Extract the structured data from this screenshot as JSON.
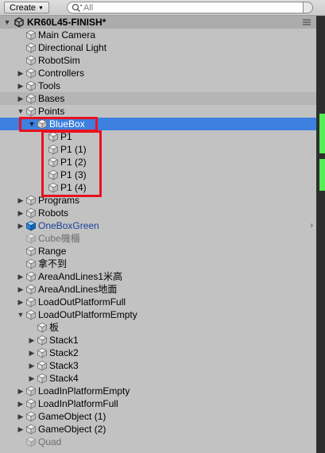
{
  "toolbar": {
    "create_label": "Create",
    "search_placeholder": "All"
  },
  "scene": {
    "title": "KR60L45-FINISH*",
    "icon": "unity-icon"
  },
  "rows": [
    {
      "label": "Main Camera",
      "depth": 1,
      "fold": "none",
      "icon": "gameobject-icon",
      "style": ""
    },
    {
      "label": "Directional Light",
      "depth": 1,
      "fold": "none",
      "icon": "gameobject-icon",
      "style": ""
    },
    {
      "label": "RobotSim",
      "depth": 1,
      "fold": "none",
      "icon": "gameobject-icon",
      "style": ""
    },
    {
      "label": "Controllers",
      "depth": 1,
      "fold": "collapsed",
      "icon": "gameobject-icon",
      "style": ""
    },
    {
      "label": "Tools",
      "depth": 1,
      "fold": "collapsed",
      "icon": "gameobject-icon",
      "style": ""
    },
    {
      "label": "Bases",
      "depth": 1,
      "fold": "collapsed",
      "icon": "gameobject-icon",
      "style": "section"
    },
    {
      "label": "Points",
      "depth": 1,
      "fold": "expanded",
      "icon": "gameobject-icon",
      "style": ""
    },
    {
      "label": "BlueBox",
      "depth": 2,
      "fold": "expanded",
      "icon": "gameobject-icon",
      "style": "selected"
    },
    {
      "label": "P1",
      "depth": 3,
      "fold": "none",
      "icon": "gameobject-icon",
      "style": ""
    },
    {
      "label": "P1 (1)",
      "depth": 3,
      "fold": "none",
      "icon": "gameobject-icon",
      "style": ""
    },
    {
      "label": "P1 (2)",
      "depth": 3,
      "fold": "none",
      "icon": "gameobject-icon",
      "style": ""
    },
    {
      "label": "P1 (3)",
      "depth": 3,
      "fold": "none",
      "icon": "gameobject-icon",
      "style": ""
    },
    {
      "label": "P1 (4)",
      "depth": 3,
      "fold": "none",
      "icon": "gameobject-icon",
      "style": ""
    },
    {
      "label": "Programs",
      "depth": 1,
      "fold": "collapsed",
      "icon": "gameobject-icon",
      "style": ""
    },
    {
      "label": "Robots",
      "depth": 1,
      "fold": "collapsed",
      "icon": "gameobject-icon",
      "style": ""
    },
    {
      "label": "OneBoxGreen",
      "depth": 1,
      "fold": "collapsed",
      "icon": "prefab-icon",
      "style": "prefab",
      "chevron": true
    },
    {
      "label": "Cube機櫃",
      "depth": 1,
      "fold": "none",
      "icon": "gameobject-icon",
      "style": "inactive"
    },
    {
      "label": "Range",
      "depth": 1,
      "fold": "none",
      "icon": "gameobject-icon",
      "style": ""
    },
    {
      "label": "拿不到",
      "depth": 1,
      "fold": "none",
      "icon": "gameobject-icon",
      "style": ""
    },
    {
      "label": "AreaAndLines1米高",
      "depth": 1,
      "fold": "collapsed",
      "icon": "gameobject-icon",
      "style": ""
    },
    {
      "label": "AreaAndLines地面",
      "depth": 1,
      "fold": "collapsed",
      "icon": "gameobject-icon",
      "style": ""
    },
    {
      "label": "LoadOutPlatformFull",
      "depth": 1,
      "fold": "collapsed",
      "icon": "gameobject-icon",
      "style": ""
    },
    {
      "label": "LoadOutPlatformEmpty",
      "depth": 1,
      "fold": "expanded",
      "icon": "gameobject-icon",
      "style": ""
    },
    {
      "label": "板",
      "depth": 2,
      "fold": "none",
      "icon": "gameobject-icon",
      "style": ""
    },
    {
      "label": "Stack1",
      "depth": 2,
      "fold": "collapsed",
      "icon": "gameobject-icon",
      "style": ""
    },
    {
      "label": "Stack2",
      "depth": 2,
      "fold": "collapsed",
      "icon": "gameobject-icon",
      "style": ""
    },
    {
      "label": "Stack3",
      "depth": 2,
      "fold": "collapsed",
      "icon": "gameobject-icon",
      "style": ""
    },
    {
      "label": "Stack4",
      "depth": 2,
      "fold": "collapsed",
      "icon": "gameobject-icon",
      "style": ""
    },
    {
      "label": "LoadInPlatformEmpty",
      "depth": 1,
      "fold": "collapsed",
      "icon": "gameobject-icon",
      "style": ""
    },
    {
      "label": "LoadInPlatformFull",
      "depth": 1,
      "fold": "collapsed",
      "icon": "gameobject-icon",
      "style": ""
    },
    {
      "label": "GameObject (1)",
      "depth": 1,
      "fold": "collapsed",
      "icon": "gameobject-icon",
      "style": ""
    },
    {
      "label": "GameObject (2)",
      "depth": 1,
      "fold": "collapsed",
      "icon": "gameobject-icon",
      "style": ""
    },
    {
      "label": "Quad",
      "depth": 1,
      "fold": "none",
      "icon": "gameobject-icon",
      "style": "inactive"
    }
  ],
  "colors": {
    "selection": "#3d80df",
    "highlight_box": "#e8121f",
    "prefab_text": "#1a3f9a",
    "inactive_text": "#6f6f6f"
  }
}
